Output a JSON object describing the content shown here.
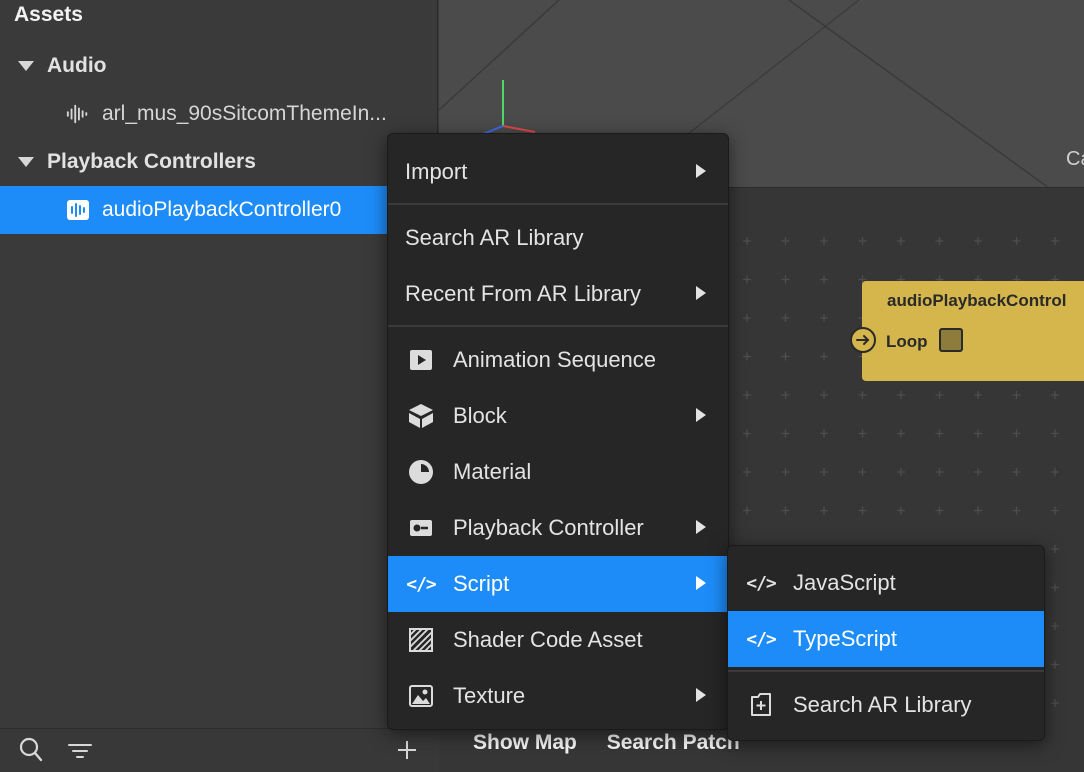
{
  "assets": {
    "title": "Assets",
    "groups": [
      {
        "label": "Audio",
        "items": [
          {
            "label": "arl_mus_90sSitcomThemeIn...",
            "icon": "audio-waveform-icon"
          }
        ]
      },
      {
        "label": "Playback Controllers",
        "items": [
          {
            "label": "audioPlaybackController0",
            "icon": "playback-controller-icon",
            "selected": true
          }
        ]
      }
    ],
    "footer": {
      "search_icon": "search-icon",
      "filter_icon": "filter-icon",
      "add_icon": "plus-icon"
    }
  },
  "viewport": {
    "corner_label": "Ca"
  },
  "patch_editor": {
    "node": {
      "title": "audioPlaybackControl",
      "port_label": "Loop"
    },
    "footer": {
      "show_map": "Show Map",
      "search_patch": "Search Patch"
    },
    "node_color": "#d4b64c"
  },
  "context_menu": {
    "items": [
      {
        "label": "Import",
        "has_submenu": true
      },
      {
        "label": "Search AR Library",
        "has_submenu": false
      },
      {
        "label": "Recent From AR Library",
        "has_submenu": true
      },
      {
        "label": "Animation Sequence",
        "icon": "play-square-icon"
      },
      {
        "label": "Block",
        "icon": "cube-icon",
        "has_submenu": true
      },
      {
        "label": "Material",
        "icon": "material-sphere-icon"
      },
      {
        "label": "Playback Controller",
        "icon": "playback-controller-icon",
        "has_submenu": true
      },
      {
        "label": "Script",
        "icon": "code-icon",
        "has_submenu": true,
        "active": true
      },
      {
        "label": "Shader Code Asset",
        "icon": "hatched-square-icon"
      },
      {
        "label": "Texture",
        "icon": "image-icon",
        "has_submenu": true
      }
    ],
    "code_glyph": "</>"
  },
  "submenu": {
    "items": [
      {
        "label": "JavaScript",
        "icon": "code-icon"
      },
      {
        "label": "TypeScript",
        "icon": "code-icon",
        "active": true
      },
      {
        "label": "Search AR Library",
        "icon": "add-file-icon"
      }
    ]
  },
  "colors": {
    "accent": "#1d8cf8",
    "menu_bg": "#262626",
    "panel_bg": "#3a3a3a"
  }
}
